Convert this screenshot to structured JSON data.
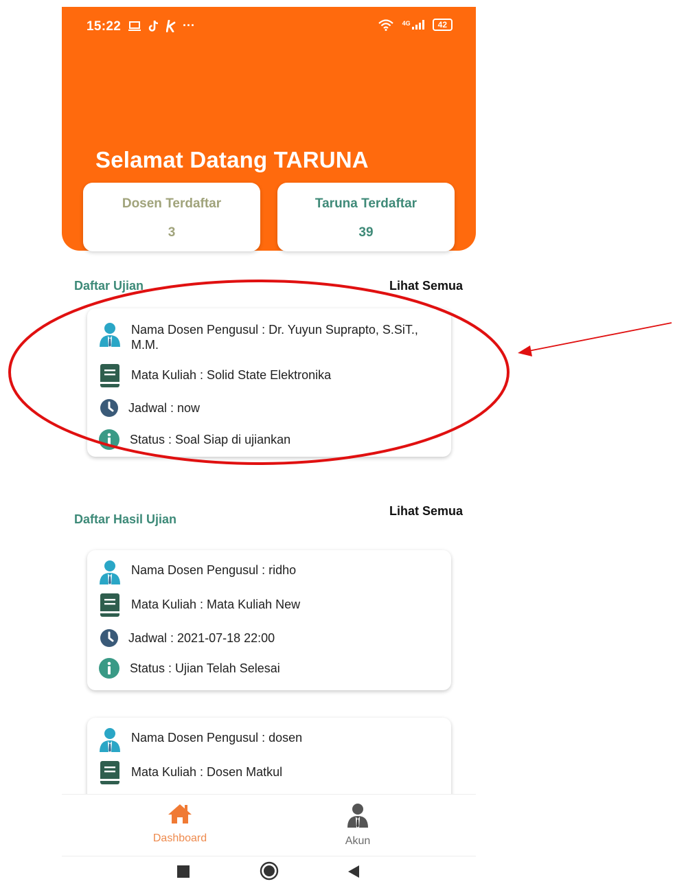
{
  "status_bar": {
    "time": "15:22",
    "left_icons": [
      "laptop-icon",
      "tiktok-icon",
      "k-app-icon"
    ],
    "more": "···",
    "network": "4G",
    "battery": "42"
  },
  "header": {
    "welcome": "Selamat Datang TARUNA",
    "accent_color": "#ff6a0d"
  },
  "stats": [
    {
      "label": "Dosen Terdaftar",
      "value": "3"
    },
    {
      "label": "Taruna Terdaftar",
      "value": "39"
    }
  ],
  "exam_list": {
    "title": "Daftar Ujian",
    "see_all": "Lihat Semua",
    "items": [
      {
        "lecturer": "Nama Dosen Pengusul : Dr. Yuyun Suprapto, S.SiT., M.M.",
        "course": "Mata Kuliah : Solid State Elektronika",
        "schedule": "Jadwal : now",
        "status": "Status : Soal Siap di ujiankan"
      }
    ]
  },
  "results_list": {
    "title": "Daftar Hasil Ujian",
    "see_all": "Lihat Semua",
    "items": [
      {
        "lecturer": "Nama Dosen Pengusul : ridho",
        "course": "Mata Kuliah : Mata Kuliah New",
        "schedule": "Jadwal : 2021-07-18 22:00",
        "status": "Status : Ujian Telah Selesai"
      },
      {
        "lecturer": "Nama Dosen Pengusul : dosen",
        "course": "Mata Kuliah : Dosen Matkul"
      }
    ]
  },
  "bottom_nav": {
    "items": [
      {
        "label": "Dashboard",
        "icon": "home-icon",
        "active": true
      },
      {
        "label": "Akun",
        "icon": "user-icon",
        "active": false
      }
    ]
  },
  "colors": {
    "teal": "#3d8a78",
    "olive": "#a0a37b",
    "annotation_red": "#e01010"
  }
}
